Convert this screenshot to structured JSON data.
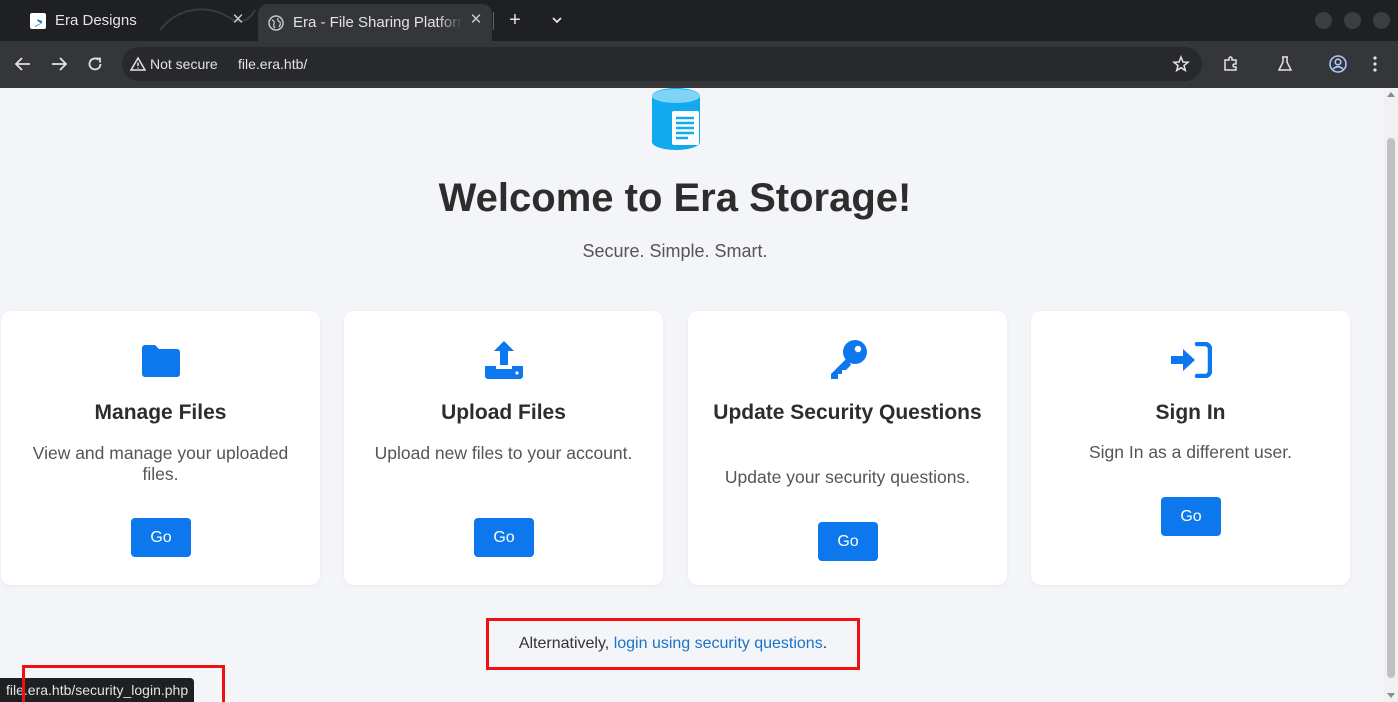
{
  "browser": {
    "tabs": [
      {
        "title": "Era Designs",
        "active": false,
        "favicon": "bing-icon"
      },
      {
        "title": "Era - File Sharing Platform",
        "active": true,
        "favicon": "globe-icon"
      }
    ],
    "address": {
      "security_label": "Not secure",
      "url": "file.era.htb/"
    },
    "status_url": "file.era.htb/security_login.php"
  },
  "page": {
    "logo": "file-storage-icon",
    "title": "Welcome to Era Storage!",
    "tagline": "Secure. Simple. Smart.",
    "cards": [
      {
        "icon": "folder-icon",
        "title": "Manage Files",
        "description": "View and manage your uploaded files.",
        "button": "Go"
      },
      {
        "icon": "upload-icon",
        "title": "Upload Files",
        "description": "Upload new files to your account.",
        "button": "Go"
      },
      {
        "icon": "key-icon",
        "title": "Update Security Questions",
        "description": "Update your security questions.",
        "button": "Go"
      },
      {
        "icon": "sign-in-icon",
        "title": "Sign In",
        "description": "Sign In as a different user.",
        "button": "Go"
      }
    ],
    "alternative": {
      "prefix": "Alternatively,",
      "link": "login using security questions",
      "suffix": "."
    }
  },
  "colors": {
    "accent": "#0d77ee",
    "highlight_border": "#ee1111",
    "background": "#f4f5f9"
  }
}
